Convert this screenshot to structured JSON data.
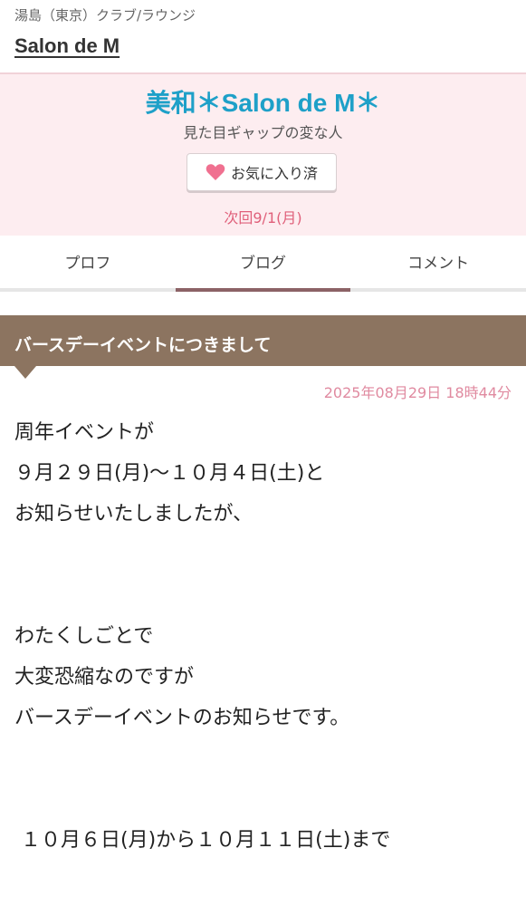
{
  "header": {
    "breadcrumb": "湯島（東京）クラブ/ラウンジ",
    "shop_name": "Salon de M"
  },
  "profile": {
    "name": "美和＊Salon de M＊",
    "catchphrase": "見た目ギャップの変な人",
    "favorite_label": "お気に入り済",
    "next_schedule": "次回9/1(月)"
  },
  "tabs": [
    {
      "label": "プロフ"
    },
    {
      "label": "ブログ"
    },
    {
      "label": "コメント"
    }
  ],
  "article": {
    "title": "バースデーイベントにつきまして",
    "posted_at": "2025年08月29日 18時44分",
    "lines": [
      "周年イベントが",
      "９月２９日(月)〜１０月４日(土)と",
      "お知らせいたしましたが、",
      "",
      "",
      "わたくしごとで",
      "大変恐縮なのですが",
      "バースデーイベントのお知らせです。",
      "",
      "",
      " １０月６日(月)から１０月１１日(土)まで"
    ]
  },
  "colors": {
    "accent_name": "#1ea0c8",
    "profile_bg": "#fdedf0",
    "heart": "#f07090",
    "title_bar": "#8c7460",
    "tab_active": "#8c6266",
    "date_pink": "#e08aa0"
  }
}
